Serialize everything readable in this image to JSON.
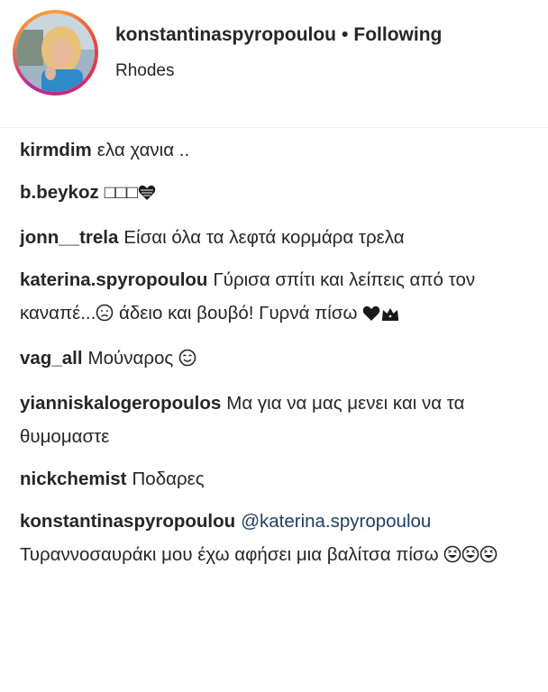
{
  "header": {
    "username": "konstantinaspyropoulou",
    "separator": "•",
    "follow_state": "Following",
    "location": "Rhodes"
  },
  "comments": [
    {
      "user": "kirmdim",
      "text": "ελα χανια .."
    },
    {
      "user": "b.beykoz",
      "text": "□□□",
      "icons": [
        "heart-icon"
      ]
    },
    {
      "user": "jonn__trela",
      "text": "Είσαι όλα τα λεφτά κορμάρα τρελα"
    },
    {
      "user": "katerina.spyropoulou",
      "text_before": "Γύρισα σπίτι και λείπεις από τον καναπέ...",
      "text_after": " άδειο και βουβό! Γυρνά πίσω ",
      "icons": [
        "sad-face-icon",
        "black-heart-icon",
        "crown-icon"
      ]
    },
    {
      "user": "vag_all",
      "text": "Μούναρος ",
      "icons": [
        "smiling-face-icon"
      ]
    },
    {
      "user": "yianniskalogeropoulos",
      "text": "Μα για να μας μενει και να τα θυμομαστε"
    },
    {
      "user": "nickchemist",
      "text": "Ποδαρες"
    },
    {
      "user": "konstantinaspyropoulou",
      "mention": "@katerina.spyropoulou",
      "text": " Τυραννοσαυράκι μου έχω αφήσει μια βαλίτσα πίσω ",
      "icons": [
        "laughing-face-icon",
        "laughing-face-icon",
        "laughing-face-icon"
      ]
    }
  ]
}
